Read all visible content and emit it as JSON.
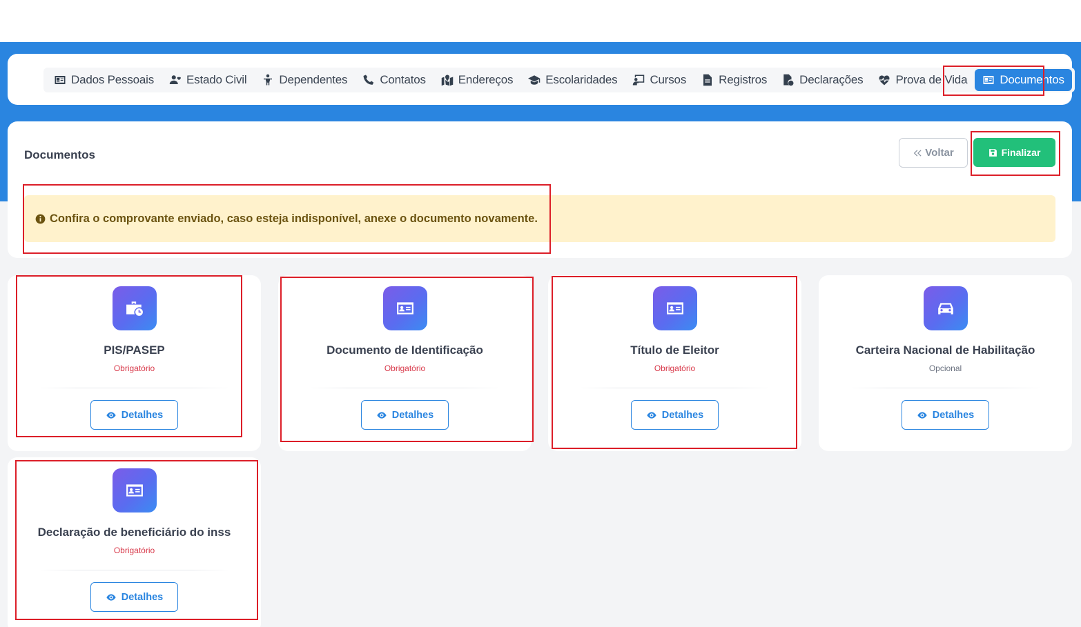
{
  "nav": {
    "items": [
      {
        "label": "Dados Pessoais",
        "icon": "id-card-icon"
      },
      {
        "label": "Estado Civil",
        "icon": "user-heart-icon"
      },
      {
        "label": "Dependentes",
        "icon": "child-icon"
      },
      {
        "label": "Contatos",
        "icon": "phone-icon"
      },
      {
        "label": "Endereços",
        "icon": "map-marker-icon"
      },
      {
        "label": "Escolaridades",
        "icon": "graduation-cap-icon"
      },
      {
        "label": "Cursos",
        "icon": "chalkboard-icon"
      },
      {
        "label": "Registros",
        "icon": "file-icon"
      },
      {
        "label": "Declarações",
        "icon": "file-signature-icon"
      },
      {
        "label": "Prova de Vida",
        "icon": "heartbeat-icon"
      },
      {
        "label": "Documentos",
        "icon": "id-card-icon",
        "active": true
      }
    ]
  },
  "page": {
    "title": "Documentos",
    "back_label": "Voltar",
    "finish_label": "Finalizar"
  },
  "alert": {
    "text": "Confira o comprovante enviado, caso esteja indisponível, anexe o documento novamente.",
    "icon": "info-circle-icon"
  },
  "documents": [
    {
      "title": "PIS/PASEP",
      "status": "Obrigatório",
      "icon": "briefcase-clock-icon",
      "button": "Detalhes"
    },
    {
      "title": "Documento de Identificação",
      "status": "Obrigatório",
      "icon": "id-card-icon",
      "button": "Detalhes"
    },
    {
      "title": "Título de Eleitor",
      "status": "Obrigatório",
      "icon": "id-card-icon",
      "button": "Detalhes"
    },
    {
      "title": "Carteira Nacional de Habilitação",
      "status": "Opcional",
      "icon": "car-icon",
      "button": "Detalhes"
    },
    {
      "title": "Declaração de beneficiário do inss",
      "status": "Obrigatório",
      "icon": "id-card-icon",
      "button": "Detalhes"
    }
  ],
  "colors": {
    "primary": "#2a85e0",
    "success": "#22c07a",
    "required": "#d8394a",
    "highlight": "#dc1e28",
    "alert_bg": "#fff2cc"
  }
}
